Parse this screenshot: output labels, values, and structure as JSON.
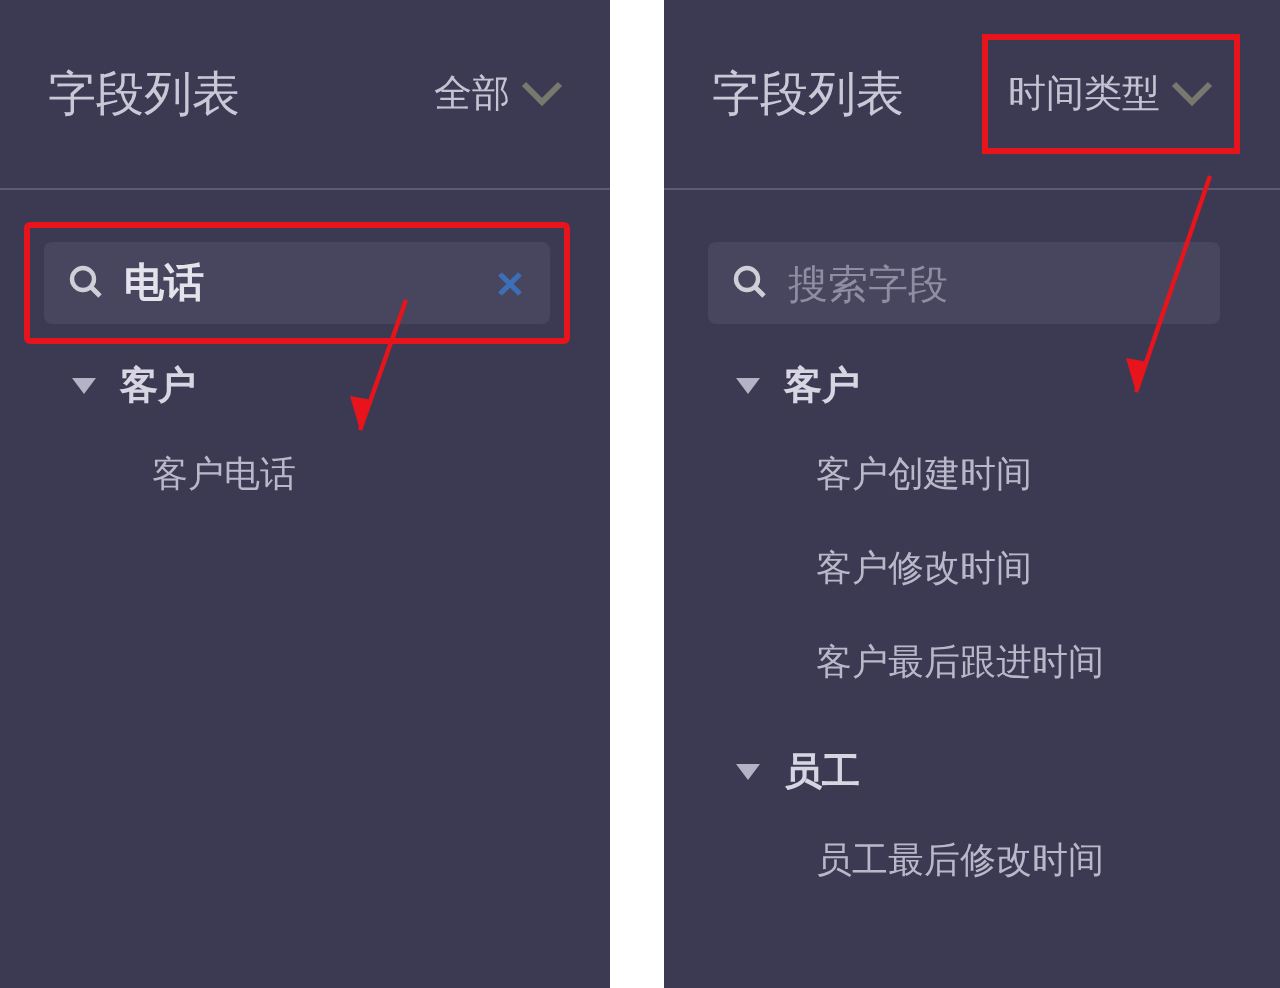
{
  "panels": [
    {
      "title": "字段列表",
      "filter": {
        "label": "全部",
        "highlighted": false
      },
      "search": {
        "value": "电话",
        "highlighted": true,
        "clearable": true
      },
      "groups": [
        {
          "label": "客户",
          "expanded": true,
          "children": [
            {
              "label": "客户电话"
            }
          ]
        }
      ]
    },
    {
      "title": "字段列表",
      "filter": {
        "label": "时间类型",
        "highlighted": true
      },
      "search": {
        "placeholder": "搜索字段",
        "highlighted": false,
        "clearable": false
      },
      "groups": [
        {
          "label": "客户",
          "expanded": true,
          "children": [
            {
              "label": "客户创建时间"
            },
            {
              "label": "客户修改时间"
            },
            {
              "label": "客户最后跟进时间"
            }
          ]
        },
        {
          "label": "员工",
          "expanded": true,
          "children": [
            {
              "label": "员工最后修改时间"
            }
          ]
        }
      ]
    }
  ]
}
